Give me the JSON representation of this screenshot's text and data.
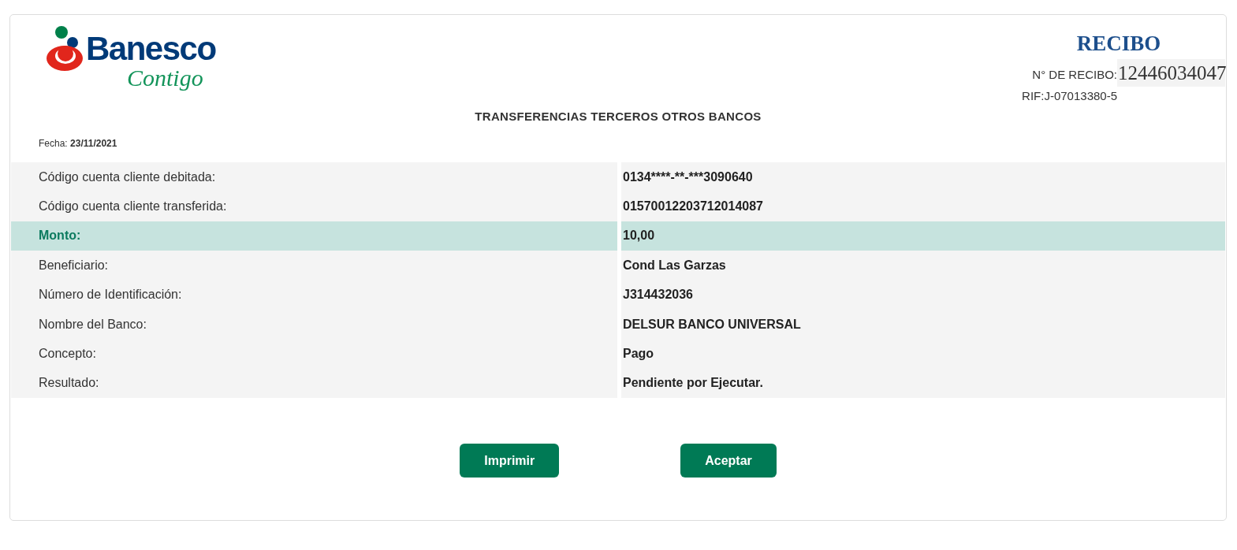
{
  "logo": {
    "name": "Banesco",
    "tagline": "Contigo"
  },
  "receipt": {
    "title": "RECIBO",
    "number_label": "N° DE RECIBO:",
    "number": "12446034047",
    "rif": "RIF:J-07013380-5"
  },
  "heading": "TRANSFERENCIAS TERCEROS OTROS BANCOS",
  "date": {
    "label": "Fecha:",
    "value": "23/11/2021"
  },
  "details": [
    {
      "label": "Código cuenta cliente debitada:",
      "value": "0134****-**-***3090640",
      "highlighted": false
    },
    {
      "label": "Código cuenta cliente transferida:",
      "value": "01570012203712014087",
      "highlighted": false
    },
    {
      "label": "Monto:",
      "value": "10,00",
      "highlighted": true
    },
    {
      "label": "Beneficiario:",
      "value": "Cond Las Garzas",
      "highlighted": false
    },
    {
      "label": "Número de Identificación:",
      "value": "J314432036",
      "highlighted": false
    },
    {
      "label": "Nombre del Banco:",
      "value": "DELSUR BANCO UNIVERSAL",
      "highlighted": false
    },
    {
      "label": "Concepto:",
      "value": "Pago",
      "highlighted": false
    },
    {
      "label": "Resultado:",
      "value": "Pendiente por Ejecutar.",
      "highlighted": false
    }
  ],
  "buttons": [
    {
      "label": "Imprimir"
    },
    {
      "label": "Aceptar"
    }
  ]
}
